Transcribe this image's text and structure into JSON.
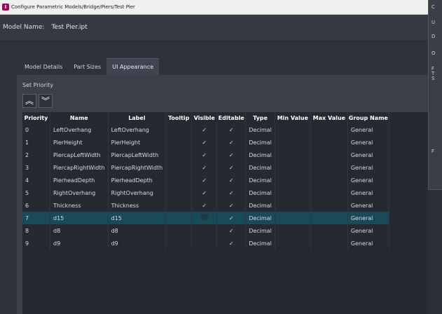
{
  "window": {
    "title": "Configure Parametric Models/Bridge/Piers/Test Pier",
    "icon": "app-icon"
  },
  "model": {
    "name_label": "Model Name:",
    "name_value": "Test Pier.ipt"
  },
  "tabs": [
    {
      "label": "Model Details",
      "active": false
    },
    {
      "label": "Part Sizes",
      "active": false
    },
    {
      "label": "UI Appearance",
      "active": true
    }
  ],
  "priority": {
    "label": "Set Priority",
    "up_icon": "double-chevron-up-icon",
    "down_icon": "double-chevron-down-icon"
  },
  "table": {
    "columns": [
      "Priority",
      "Name",
      "Label",
      "Tooltip",
      "Visible",
      "Editable",
      "Type",
      "Min Value",
      "Max Value",
      "Group Name"
    ],
    "rows": [
      {
        "priority": "0",
        "name": "LeftOverhang",
        "label": "LeftOverhang",
        "tooltip": "",
        "visible": "✓",
        "editable": "✓",
        "type": "Decimal",
        "min": "",
        "max": "",
        "group": "General"
      },
      {
        "priority": "1",
        "name": "PierHeight",
        "label": "PierHeight",
        "tooltip": "",
        "visible": "✓",
        "editable": "✓",
        "type": "Decimal",
        "min": "",
        "max": "",
        "group": "General"
      },
      {
        "priority": "2",
        "name": "PiercapLeftWidth",
        "label": "PiercapLeftWidth",
        "tooltip": "",
        "visible": "✓",
        "editable": "✓",
        "type": "Decimal",
        "min": "",
        "max": "",
        "group": "General"
      },
      {
        "priority": "3",
        "name": "PiercapRightWidth",
        "label": "PiercapRightWidth",
        "tooltip": "",
        "visible": "✓",
        "editable": "✓",
        "type": "Decimal",
        "min": "",
        "max": "",
        "group": "General"
      },
      {
        "priority": "4",
        "name": "PierheadDepth",
        "label": "PierheadDepth",
        "tooltip": "",
        "visible": "✓",
        "editable": "✓",
        "type": "Decimal",
        "min": "",
        "max": "",
        "group": "General"
      },
      {
        "priority": "5",
        "name": "RightOverhang",
        "label": "RightOverhang",
        "tooltip": "",
        "visible": "✓",
        "editable": "✓",
        "type": "Decimal",
        "min": "",
        "max": "",
        "group": "General"
      },
      {
        "priority": "6",
        "name": "Thickness",
        "label": "Thickness",
        "tooltip": "",
        "visible": "✓",
        "editable": "✓",
        "type": "Decimal",
        "min": "",
        "max": "",
        "group": "General"
      },
      {
        "priority": "7",
        "name": "d15",
        "label": "d15",
        "tooltip": "",
        "visible": "",
        "editable": "✓",
        "type": "Decimal",
        "min": "",
        "max": "",
        "group": "General",
        "selected": true
      },
      {
        "priority": "8",
        "name": "d8",
        "label": "d8",
        "tooltip": "",
        "visible": "",
        "editable": "✓",
        "type": "Decimal",
        "min": "",
        "max": "",
        "group": "General"
      },
      {
        "priority": "9",
        "name": "d9",
        "label": "d9",
        "tooltip": "",
        "visible": "",
        "editable": "✓",
        "type": "Decimal",
        "min": "",
        "max": "",
        "group": "General"
      }
    ]
  },
  "right_panel": {
    "letters": [
      "C",
      "U",
      "D",
      "O",
      "F",
      "T",
      "S",
      "F"
    ]
  },
  "colors": {
    "selected_row": "#194a57",
    "accent_icon": "#b5005a"
  }
}
